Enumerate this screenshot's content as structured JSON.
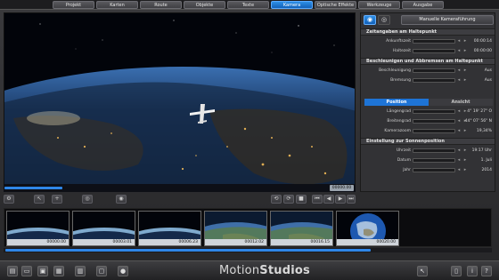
{
  "tabs": [
    "Projekt",
    "Karten",
    "Route",
    "Objekte",
    "Texte",
    "Kamera",
    "Optische Effekte",
    "Werkzeuge",
    "Ausgabe"
  ],
  "active_tab": "Kamera",
  "viewport": {
    "timecode": "00000.00",
    "progress": 0.18
  },
  "panel": {
    "manual_button": "Manuelle Kameraführung",
    "sec_zeit": "Zeitangaben am Haltepunkt",
    "zeit_rows": [
      {
        "label": "Ankunftszeit",
        "value": "00:00:14"
      },
      {
        "label": "Haltezeit",
        "value": "00:00:00"
      }
    ],
    "sec_beschl": "Beschleunigen und Abbremsen am Haltepunkt",
    "beschl_rows": [
      {
        "label": "Beschleunigung",
        "value": "Aus"
      },
      {
        "label": "Bremsung",
        "value": "Aus"
      }
    ],
    "pos_tab": "Position",
    "ans_tab": "Ansicht",
    "pos_rows": [
      {
        "label": "Längengrad",
        "value": "4° 19' 27\" O"
      },
      {
        "label": "Breitengrad",
        "value": "44° 07' 56\" N"
      },
      {
        "label": "Kamerazoom",
        "value": "19,34%"
      }
    ],
    "sec_sonne": "Einstellung zur Sonnenposition",
    "sonne_rows": [
      {
        "label": "Uhrzeit",
        "value": "19:17 Uhr"
      },
      {
        "label": "Datum",
        "value": "1. Juli"
      },
      {
        "label": "Jahr",
        "value": "2014"
      }
    ]
  },
  "thumbnails": [
    {
      "time": "00000.00",
      "kind": "horizon"
    },
    {
      "time": "00003.01",
      "kind": "horizon"
    },
    {
      "time": "00006.23",
      "kind": "horizon"
    },
    {
      "time": "00012.02",
      "kind": "green"
    },
    {
      "time": "00016.15",
      "kind": "green"
    },
    {
      "time": "00020.00",
      "kind": "globe"
    }
  ],
  "brand": {
    "part1": "Motion",
    "part2": "Studios"
  },
  "colors": {
    "accent": "#1e74d6",
    "panel": "#323235"
  }
}
